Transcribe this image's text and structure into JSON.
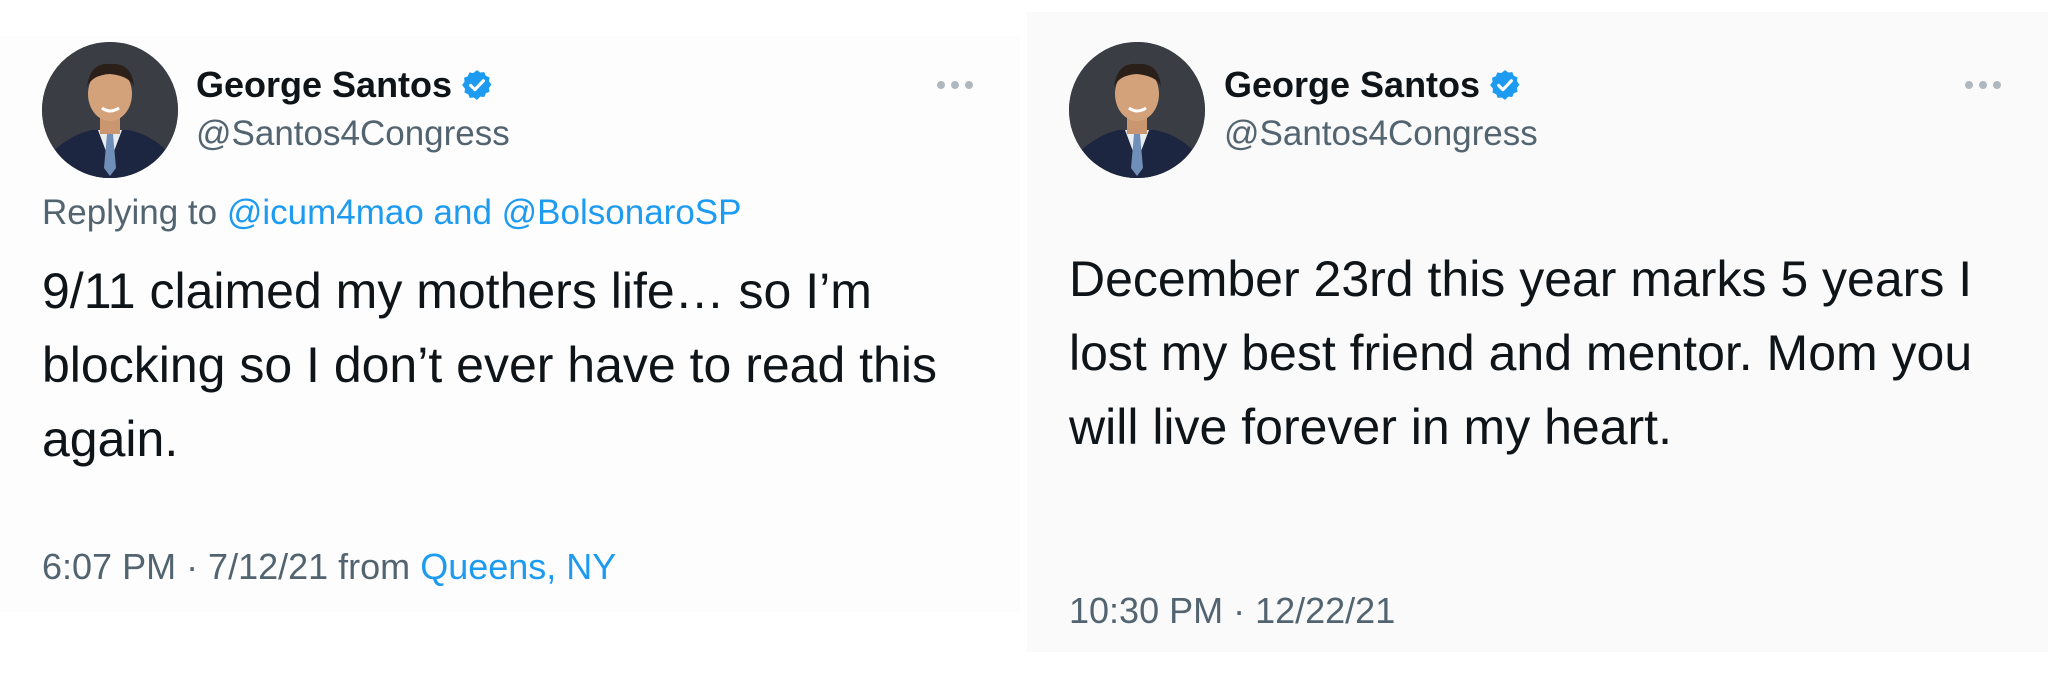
{
  "tweets": [
    {
      "author_name": "George Santos",
      "handle": "@Santos4Congress",
      "reply_prefix": "Replying to ",
      "reply_users": "@icum4mao and @BolsonaroSP",
      "text": "9/11 claimed my mothers life… so I’m blocking so I don’t ever have to read this again.",
      "time": "6:07 PM · 7/12/21",
      "from_prefix": " from ",
      "location": "Queens, NY"
    },
    {
      "author_name": "George Santos",
      "handle": "@Santos4Congress",
      "text": "December 23rd this year marks 5 years I lost my best friend and mentor. Mom you will live forever in my heart.",
      "time": "10:30 PM · 12/22/21"
    }
  ],
  "icons": {
    "verified": "verified-badge-icon",
    "more": "more-options-icon"
  },
  "colors": {
    "text": "#0f1419",
    "secondary": "#536471",
    "link": "#1d9bf0"
  }
}
